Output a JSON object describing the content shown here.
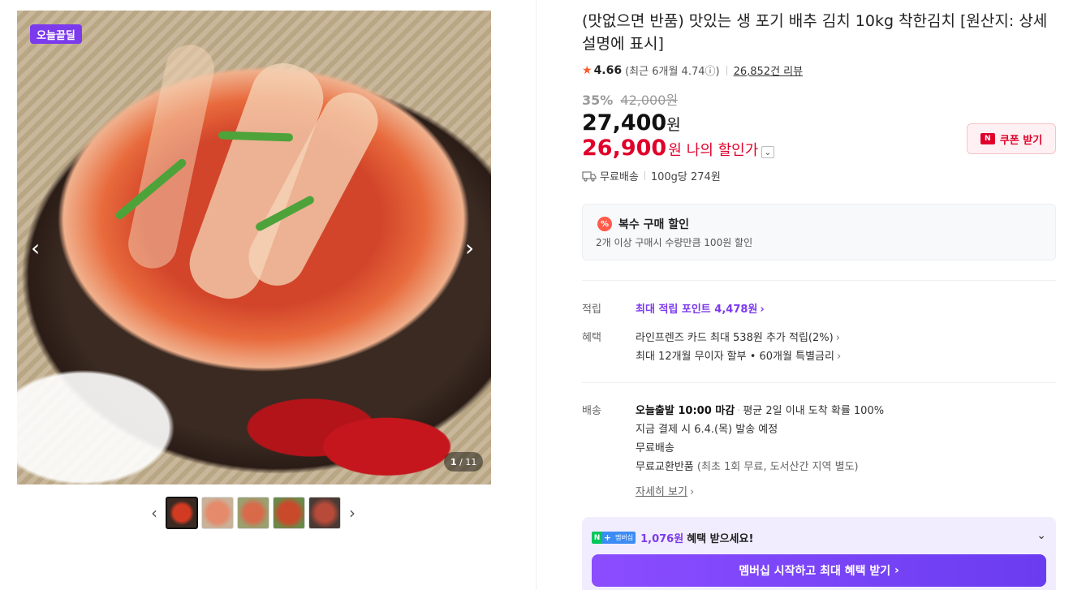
{
  "gallery": {
    "badge": "오늘끝딜",
    "prev_arrow": "‹",
    "next_arrow": "›",
    "counter_current": "1",
    "counter_total": "/ 11",
    "thumb_prev": "‹",
    "thumb_next": "›"
  },
  "product": {
    "title": "(맛없으면 반품) 맛있는 생 포기 배추 김치 10kg 착한김치 [원산지: 상세설명에 표시]",
    "rating": {
      "score": "4.66",
      "recent": "(최근 6개월 4.74ⓘ)",
      "reviews": "26,852건 리뷰"
    },
    "discount_rate": "35%",
    "original_price": "42,000원",
    "price": "27,400",
    "price_unit": "원",
    "my_price": "26,900",
    "my_price_unit": "원",
    "my_price_label": "나의 할인가",
    "coupon_label": "쿠폰 받기",
    "shipping": "무료배송",
    "unit_price": "100g당 274원"
  },
  "multi_discount": {
    "icon": "%",
    "title": "복수 구매 할인",
    "desc": "2개 이상 구매시 수량만큼 100원 할인"
  },
  "benefits": {
    "points_label": "적립",
    "points_value": "최대 적립 포인트 4,478원",
    "benefit_label": "혜택",
    "benefit_1": "라인프렌즈 카드 최대 538원 추가 적립(2%)",
    "benefit_2": "최대 12개월 무이자 할부 • 60개월 특별금리"
  },
  "delivery": {
    "label": "배송",
    "line1_bold": "오늘출발 10:00 마감",
    "line1_rest": "평균 2일 이내 도착 확률 100%",
    "line2": "지금 결제 시 6.4.(목) 발송 예정",
    "line3": "무료배송",
    "line4_main": "무료교환반품",
    "line4_note": "(최초 1회 무료, 도서산간 지역 별도)",
    "more": "자세히 보기"
  },
  "membership": {
    "logo_ms": "멤버십",
    "amount": "1,076원",
    "text": "혜택 받으세요!",
    "button": "멤버십 시작하고 최대 혜택 받기"
  }
}
